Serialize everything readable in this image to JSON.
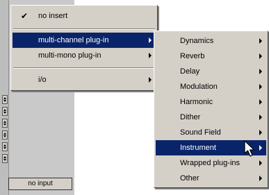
{
  "strip": {
    "input_label": "no input"
  },
  "insert_menu": {
    "no_insert": {
      "label": "no insert",
      "checked": true
    },
    "items": [
      {
        "label": "multi-channel plug-in",
        "submenu": true,
        "selected": true
      },
      {
        "label": "multi-mono plug-in",
        "submenu": true,
        "selected": false
      },
      {
        "label": "i/o",
        "submenu": true,
        "selected": false
      }
    ]
  },
  "plugin_submenu": {
    "items": [
      {
        "label": "Dynamics",
        "submenu": true
      },
      {
        "label": "Reverb",
        "submenu": true
      },
      {
        "label": "Delay",
        "submenu": true
      },
      {
        "label": "Modulation",
        "submenu": true
      },
      {
        "label": "Harmonic",
        "submenu": true
      },
      {
        "label": "Dither",
        "submenu": true
      },
      {
        "label": "Sound Field",
        "submenu": true
      },
      {
        "label": "Instrument",
        "submenu": true,
        "selected": true
      },
      {
        "label": "Wrapped plug-ins",
        "submenu": true
      },
      {
        "label": "Other",
        "submenu": true
      }
    ]
  },
  "colors": {
    "menu_bg": "#d4d0c8",
    "highlight": "#0a246a",
    "highlight_text": "#ffffff"
  },
  "icons": {
    "check": "check-icon",
    "submenu": "chevron-right-icon",
    "pointer": "mouse-pointer-icon",
    "stepper": "up-down-stepper-icon"
  }
}
